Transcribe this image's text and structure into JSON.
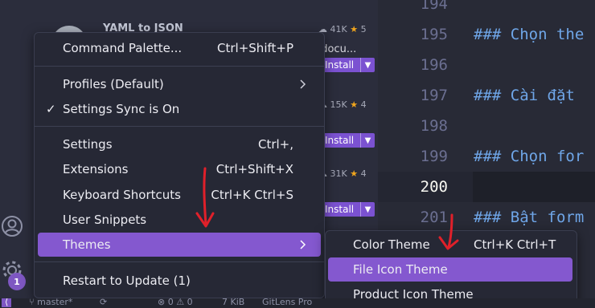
{
  "editor": {
    "lines": [
      {
        "number": "194",
        "text": ""
      },
      {
        "number": "195",
        "text": "### Chọn the"
      },
      {
        "number": "196",
        "text": ""
      },
      {
        "number": "197",
        "text": "### Cài đặt"
      },
      {
        "number": "198",
        "text": ""
      },
      {
        "number": "199",
        "text": "### Chọn for"
      },
      {
        "number": "200",
        "text": ""
      },
      {
        "number": "201",
        "text": "### Bật form"
      }
    ]
  },
  "extensions": [
    {
      "name": "YAML to JSON",
      "downloads": "41K",
      "rating": "5",
      "description": "t docu...",
      "install_label": "Install"
    },
    {
      "name": "",
      "downloads": "15K",
      "rating": "4",
      "description": "",
      "install_label": "Install"
    },
    {
      "name": "",
      "downloads": "31K",
      "rating": "4",
      "description": "",
      "install_label": "Install"
    }
  ],
  "activity_bar": {
    "badge_count": "1"
  },
  "menu": {
    "items": [
      {
        "label": "Command Palette...",
        "shortcut": "Ctrl+Shift+P"
      },
      {
        "label": "Profiles (Default)",
        "shortcut": ""
      },
      {
        "label": "Settings Sync is On",
        "shortcut": ""
      },
      {
        "label": "Settings",
        "shortcut": "Ctrl+,"
      },
      {
        "label": "Extensions",
        "shortcut": "Ctrl+Shift+X"
      },
      {
        "label": "Keyboard Shortcuts",
        "shortcut": "Ctrl+K Ctrl+S"
      },
      {
        "label": "User Snippets",
        "shortcut": ""
      },
      {
        "label": "Themes",
        "shortcut": ""
      },
      {
        "label": "Restart to Update (1)",
        "shortcut": ""
      }
    ]
  },
  "submenu": {
    "items": [
      {
        "label": "Color Theme",
        "shortcut": "Ctrl+K Ctrl+T"
      },
      {
        "label": "File Icon Theme",
        "shortcut": ""
      },
      {
        "label": "Product Icon Theme",
        "shortcut": ""
      }
    ]
  },
  "status_bar": {
    "branch": "master*",
    "errors": "0",
    "warnings": "0",
    "size": "7 KiB",
    "gitlens": "GitLens Pro"
  },
  "colors": {
    "accent": "#8458cf",
    "annotation": "#e0202a",
    "star": "#f0a51d",
    "heading_text": "#6fa6e8"
  }
}
